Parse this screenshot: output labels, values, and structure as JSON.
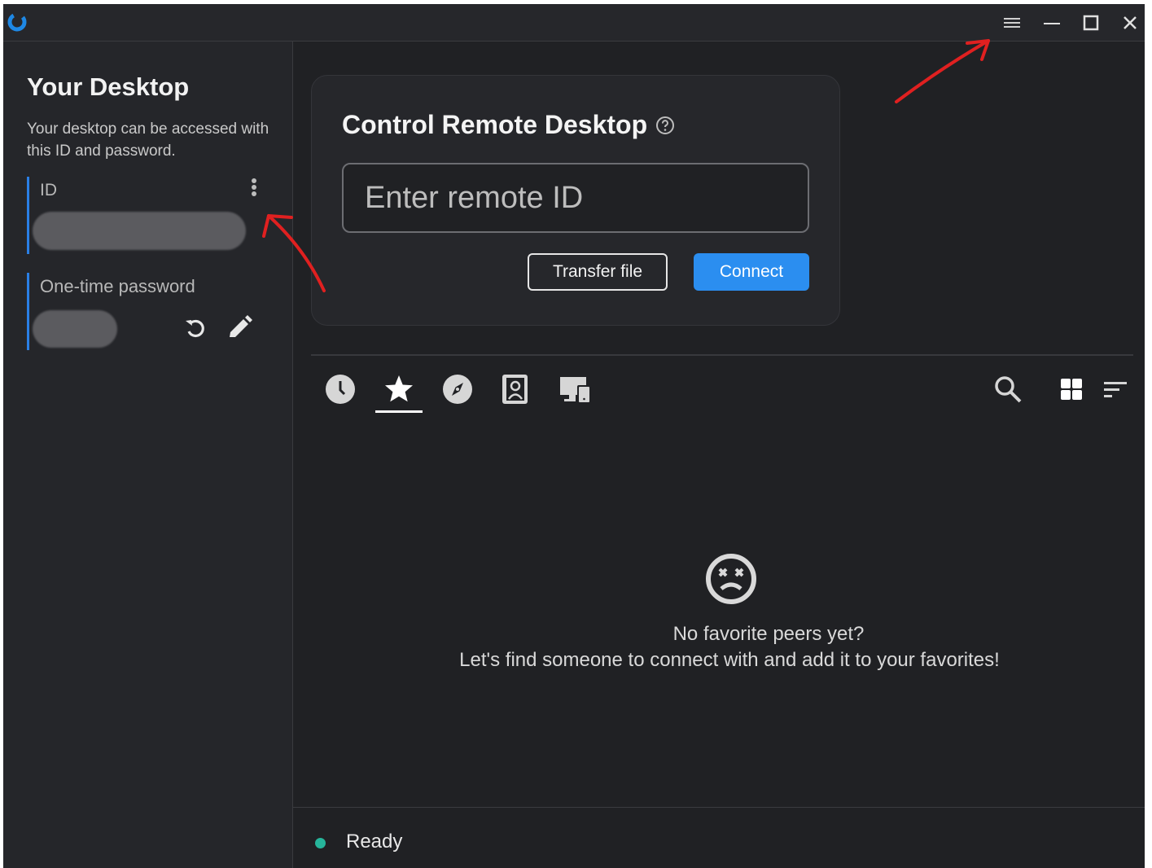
{
  "titlebar": {
    "logo_icon": "rustdesk-logo-icon",
    "menu_icon": "hamburger-menu-icon",
    "minimize_icon": "minimize-icon",
    "maximize_icon": "maximize-icon",
    "close_icon": "close-icon"
  },
  "left_panel": {
    "title": "Your Desktop",
    "description": "Your desktop can be accessed with this ID and password.",
    "id_label": "ID",
    "password_label": "One-time password"
  },
  "remote": {
    "title": "Control Remote Desktop",
    "input_placeholder": "Enter remote ID",
    "transfer_label": "Transfer file",
    "connect_label": "Connect"
  },
  "tabs": [
    {
      "icon": "recent-clock-icon"
    },
    {
      "icon": "favorites-star-icon",
      "selected": true
    },
    {
      "icon": "discovered-compass-icon"
    },
    {
      "icon": "address-book-icon"
    },
    {
      "icon": "group-devices-icon"
    }
  ],
  "empty_state": {
    "line1": "No favorite peers yet?",
    "line2": "Let's find someone to connect with and add it to your favorites!"
  },
  "status": {
    "text": "Ready",
    "dot_color": "#26b59b"
  },
  "colors": {
    "accent": "#2b8ef0",
    "annotation_arrow": "#e02020"
  }
}
